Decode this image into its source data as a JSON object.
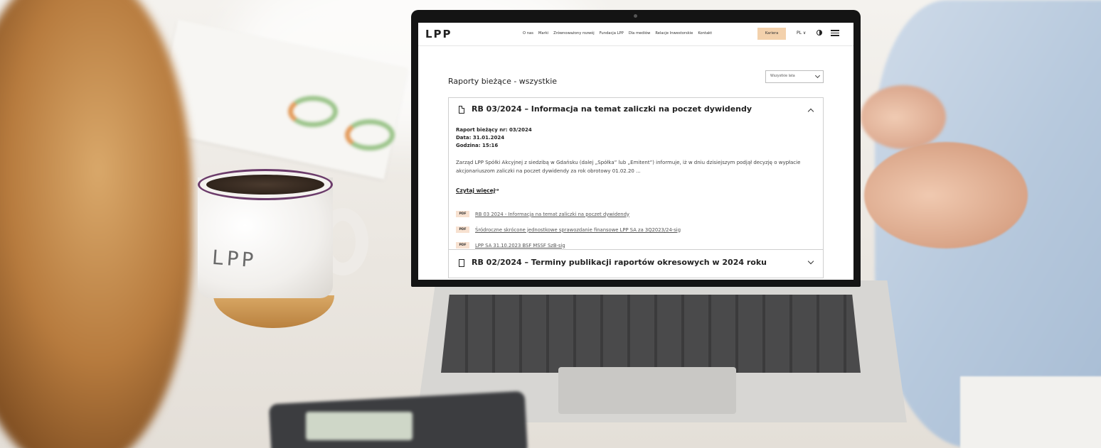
{
  "nav": {
    "logo": "LPP",
    "items": [
      "O nas",
      "Marki",
      "Zrównoważony rozwój",
      "Fundacja LPP",
      "Dla mediów",
      "Relacje Inwestorskie",
      "Kontakt"
    ],
    "career": "Kariera",
    "lang": "PL ∨"
  },
  "page": {
    "title": "Raporty bieżące - wszystkie",
    "filter": "Wszystkie lata"
  },
  "report1": {
    "title": "RB 03/2024 – Informacja na temat zaliczki na poczet dywidendy",
    "meta": [
      "Raport bieżący nr: 03/2024",
      "Data: 31.01.2024",
      "Godzina: 15:16"
    ],
    "description": "Zarząd LPP Spółki Akcyjnej z siedzibą w Gdańsku (dalej „Spółka” lub „Emitent”) informuje, iż w dniu dzisiejszym podjął decyzję o wypłacie akcjonariuszom zaliczki na poczet dywidendy za rok obrotowy 01.02.20 ...",
    "more": "Czytaj więcej",
    "more_arrow": "→",
    "pdf_badge": "PDF",
    "files": [
      "RB 03 2024 - Informacja na temat zaliczki na poczet dywidendy",
      "Śródroczne skrócone jednostkowe sprawozdanie finansowe LPP SA za 3Q2023/24-sig",
      "LPP SA 31.10.2023 BSF MSSF SzB-sig"
    ]
  },
  "report2": {
    "title": "RB 02/2024 – Terminy publikacji raportów okresowych w 2024 roku"
  },
  "mug": {
    "logo": "LPP"
  }
}
